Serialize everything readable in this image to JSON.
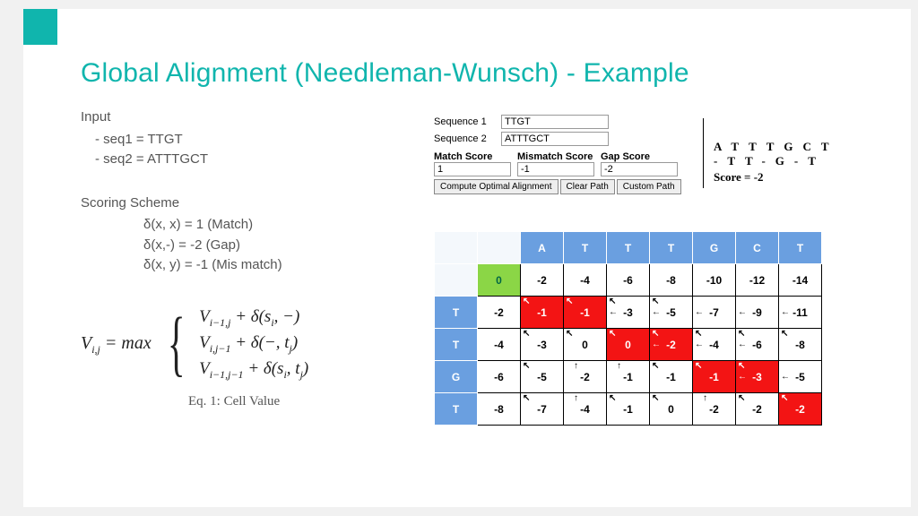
{
  "title": "Global Alignment (Needleman-Wunsch) - Example",
  "input": {
    "heading": "Input",
    "line1": "- seq1 =  TTGT",
    "line2": "- seq2 = ATTTGCT"
  },
  "scoring": {
    "heading": "Scoring Scheme",
    "line1": "δ(x, x) = 1 (Match)",
    "line2": "δ(x,-) = -2 (Gap)",
    "line3": "δ(x, y) = -1 (Mis match)"
  },
  "equation": {
    "lhs": "V",
    "lhs_sub": "i,j",
    "eq": " = max",
    "case1_a": "V",
    "case1_sub": "i−1,j",
    "case1_b": " + δ(s",
    "case1_sub2": "i",
    "case1_c": ", −)",
    "case2_a": "V",
    "case2_sub": "i,j−1",
    "case2_b": " + δ(−, t",
    "case2_sub2": "j",
    "case2_c": ")",
    "case3_a": "V",
    "case3_sub": "i−1,j−1",
    "case3_b": " + δ(s",
    "case3_sub2": "i",
    "case3_c": ", t",
    "case3_sub3": "j",
    "case3_d": ")",
    "caption": "Eq. 1: Cell Value"
  },
  "form": {
    "seq1_label": "Sequence 1",
    "seq1_value": "TTGT",
    "seq2_label": "Sequence 2",
    "seq2_value": "ATTTGCT",
    "match_label": "Match Score",
    "mismatch_label": "Mismatch Score",
    "gap_label": "Gap Score",
    "match_value": "1",
    "mismatch_value": "-1",
    "gap_value": "-2",
    "btn_compute": "Compute Optimal Alignment",
    "btn_clear": "Clear Path",
    "btn_custom": "Custom Path"
  },
  "alignment": {
    "row1": "ATTTGCT",
    "row2": "-TT-G-T",
    "score_label": "Score = ",
    "score_value": "-2"
  },
  "chart_data": {
    "type": "table",
    "description": "Needleman-Wunsch dynamic programming matrix",
    "col_headers": [
      "",
      "A",
      "T",
      "T",
      "T",
      "G",
      "C",
      "T"
    ],
    "row_headers": [
      "",
      "T",
      "T",
      "G",
      "T"
    ],
    "values": [
      [
        0,
        -2,
        -4,
        -6,
        -8,
        -10,
        -12,
        -14
      ],
      [
        -2,
        -1,
        -1,
        -3,
        -5,
        -7,
        -9,
        -11
      ],
      [
        -4,
        -3,
        0,
        0,
        -2,
        -4,
        -6,
        -8
      ],
      [
        -6,
        -5,
        -2,
        -1,
        -1,
        -1,
        -3,
        -5
      ],
      [
        -8,
        -7,
        -4,
        -1,
        0,
        -2,
        -2,
        -2
      ]
    ],
    "path_cells": [
      [
        0,
        0
      ],
      [
        1,
        1
      ],
      [
        1,
        2
      ],
      [
        2,
        3
      ],
      [
        2,
        4
      ],
      [
        3,
        5
      ],
      [
        3,
        6
      ],
      [
        4,
        7
      ]
    ],
    "arrows": {
      "1,1": [
        "d"
      ],
      "1,2": [
        "d"
      ],
      "1,3": [
        "d",
        "l"
      ],
      "1,4": [
        "d",
        "l"
      ],
      "1,5": [
        "l"
      ],
      "1,6": [
        "l"
      ],
      "1,7": [
        "l"
      ],
      "2,1": [
        "d"
      ],
      "2,2": [
        "d"
      ],
      "2,3": [
        "d"
      ],
      "2,4": [
        "d",
        "l"
      ],
      "2,5": [
        "d",
        "l"
      ],
      "2,6": [
        "d",
        "l"
      ],
      "2,7": [
        "d"
      ],
      "3,1": [
        "d"
      ],
      "3,2": [
        "u"
      ],
      "3,3": [
        "u"
      ],
      "3,4": [
        "d"
      ],
      "3,5": [
        "d"
      ],
      "3,6": [
        "d",
        "l"
      ],
      "3,7": [
        "l"
      ],
      "4,1": [
        "d"
      ],
      "4,2": [
        "u"
      ],
      "4,3": [
        "d"
      ],
      "4,4": [
        "d"
      ],
      "4,5": [
        "u"
      ],
      "4,6": [
        "d"
      ],
      "4,7": [
        "d"
      ]
    }
  }
}
